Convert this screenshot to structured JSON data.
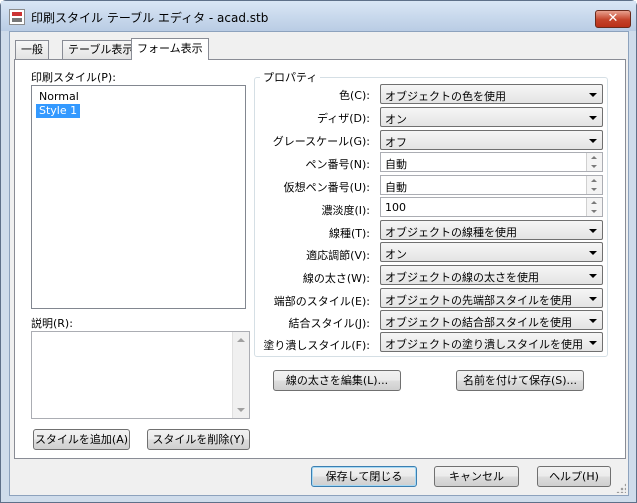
{
  "window": {
    "title": "印刷スタイル テーブル エディタ - acad.stb",
    "close_glyph": "✕"
  },
  "tabs": [
    {
      "label": "一般"
    },
    {
      "label": "テーブル表示"
    },
    {
      "label": "フォーム表示"
    }
  ],
  "active_tab": "フォーム表示",
  "styles_panel": {
    "label": "印刷スタイル(P):",
    "items": [
      {
        "label": "Normal"
      },
      {
        "label": "Style 1"
      }
    ],
    "selected": "Style 1"
  },
  "description": {
    "label": "説明(R):",
    "value": ""
  },
  "properties": {
    "legend": "プロパティ",
    "rows": [
      {
        "label": "色(C):",
        "value": "オブジェクトの色を使用",
        "control": "combo"
      },
      {
        "label": "ディザ(D):",
        "value": "オン",
        "control": "combo"
      },
      {
        "label": "グレースケール(G):",
        "value": "オフ",
        "control": "combo"
      },
      {
        "label": "ペン番号(N):",
        "value": "自動",
        "control": "spin"
      },
      {
        "label": "仮想ペン番号(U):",
        "value": "自動",
        "control": "spin"
      },
      {
        "label": "濃淡度(I):",
        "value": "100",
        "control": "spin"
      },
      {
        "label": "線種(T):",
        "value": "オブジェクトの線種を使用",
        "control": "combo"
      },
      {
        "label": "適応調節(V):",
        "value": "オン",
        "control": "combo"
      },
      {
        "label": "線の太さ(W):",
        "value": "オブジェクトの線の太さを使用",
        "control": "combo"
      },
      {
        "label": "端部のスタイル(E):",
        "value": "オブジェクトの先端部スタイルを使用",
        "control": "combo"
      },
      {
        "label": "結合スタイル(J):",
        "value": "オブジェクトの結合部スタイルを使用",
        "control": "combo"
      },
      {
        "label": "塗り潰しスタイル(F):",
        "value": "オブジェクトの塗り潰しスタイルを使用",
        "control": "combo"
      }
    ]
  },
  "buttons": {
    "edit_lineweights": "線の太さを編集(L)...",
    "save_as": "名前を付けて保存(S)...",
    "add_style": "スタイルを追加(A)",
    "delete_style": "スタイルを削除(Y)",
    "save_close": "保存して閉じる",
    "cancel": "キャンセル",
    "help": "ヘルプ(H)"
  }
}
